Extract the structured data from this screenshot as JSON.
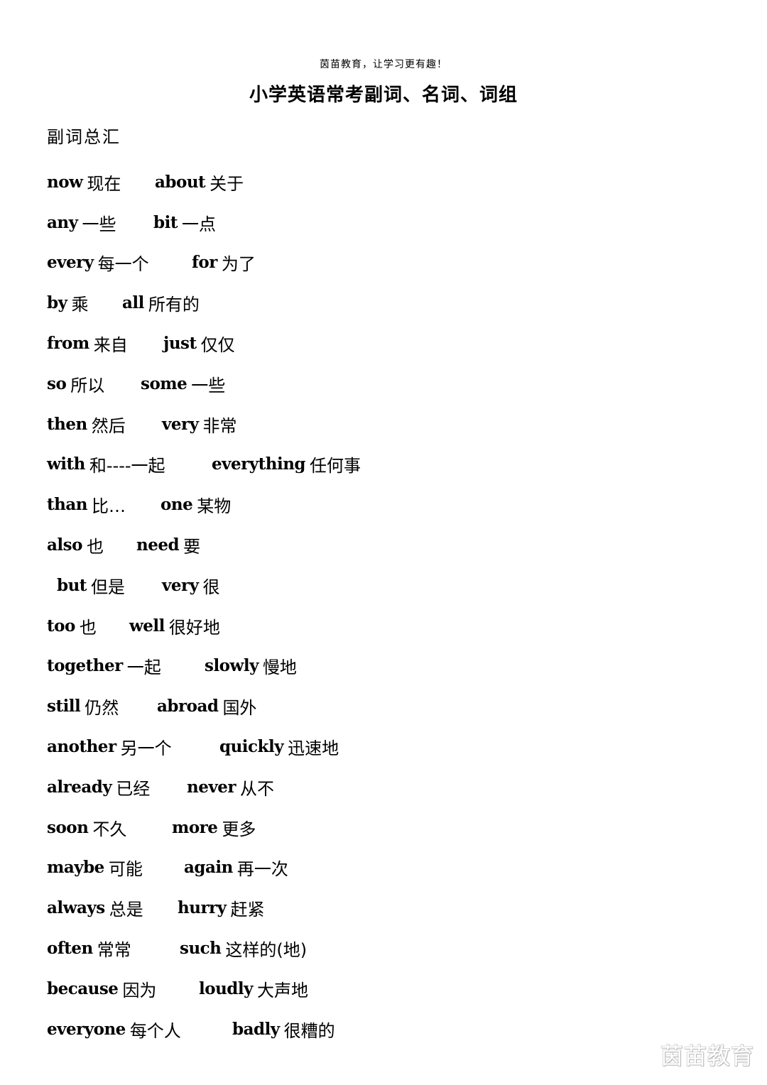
{
  "header_note": "茵苗教育，让学习更有趣！",
  "title": "小学英语常考副词、名词、词组",
  "section_heading": "副词总汇",
  "rows": [
    {
      "a_en": "now",
      "a_zh": "现在",
      "b_en": "about",
      "b_zh": "关于"
    },
    {
      "a_en": "any",
      "a_zh": "一些",
      "b_en": "bit",
      "b_zh": "一点"
    },
    {
      "a_en": "every",
      "a_zh": "每一个",
      "b_en": "for",
      "b_zh": "为了"
    },
    {
      "a_en": "by",
      "a_zh": "乘",
      "b_en": "all",
      "b_zh": "所有的"
    },
    {
      "a_en": "from",
      "a_zh": "来自",
      "b_en": "just",
      "b_zh": "仅仅"
    },
    {
      "a_en": "so",
      "a_zh": "所以",
      "b_en": "some",
      "b_zh": "一些"
    },
    {
      "a_en": "then",
      "a_zh": "然后",
      "b_en": "very",
      "b_zh": "非常"
    },
    {
      "a_en": "with",
      "a_zh": "和----一起",
      "b_en": "everything",
      "b_zh": "任何事"
    },
    {
      "a_en": "than",
      "a_zh": "比…",
      "b_en": "one",
      "b_zh": "某物"
    },
    {
      "a_en": "also",
      "a_zh": "也",
      "b_en": "need",
      "b_zh": "要"
    },
    {
      "a_en": "but",
      "a_zh": "但是",
      "b_en": "very",
      "b_zh": "很"
    },
    {
      "a_en": "too",
      "a_zh": "也",
      "b_en": "well",
      "b_zh": "很好地"
    },
    {
      "a_en": "together",
      "a_zh": "一起",
      "b_en": "slowly",
      "b_zh": "慢地"
    },
    {
      "a_en": "still",
      "a_zh": "仍然",
      "b_en": "abroad",
      "b_zh": "国外"
    },
    {
      "a_en": "another",
      "a_zh": "另一个",
      "b_en": "quickly",
      "b_zh": "迅速地"
    },
    {
      "a_en": "already",
      "a_zh": "已经",
      "b_en": "never",
      "b_zh": "从不"
    },
    {
      "a_en": "soon",
      "a_zh": "不久",
      "b_en": "more",
      "b_zh": "更多"
    },
    {
      "a_en": "maybe",
      "a_zh": "可能",
      "b_en": "again",
      "b_zh": "再一次"
    },
    {
      "a_en": "always",
      "a_zh": "总是",
      "b_en": "hurry",
      "b_zh": "赶紧"
    },
    {
      "a_en": "often",
      "a_zh": "常常",
      "b_en": "such",
      "b_zh": "这样的(地)"
    },
    {
      "a_en": "because",
      "a_zh": "因为",
      "b_en": "loudly",
      "b_zh": "大声地"
    },
    {
      "a_en": "everyone",
      "a_zh": "每个人",
      "b_en": "badly",
      "b_zh": "很糟的"
    }
  ],
  "watermark": "茵苗教育"
}
